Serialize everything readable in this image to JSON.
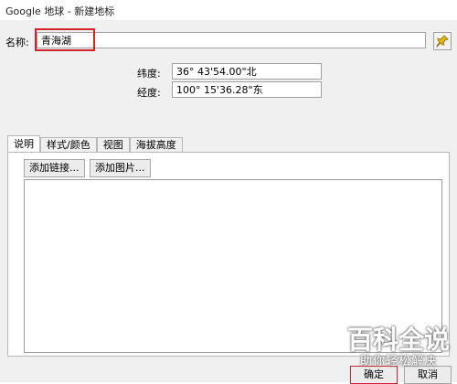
{
  "window": {
    "title": "Google 地球 - 新建地标"
  },
  "name_field": {
    "label": "名称:",
    "value": "青海湖"
  },
  "pin_icon": "pushpin-icon",
  "coordinates": {
    "latitude": {
      "label": "纬度:",
      "value": "36° 43'54.00\"北"
    },
    "longitude": {
      "label": "经度:",
      "value": "100° 15'36.28\"东"
    }
  },
  "tabs": [
    {
      "label": "说明",
      "active": true
    },
    {
      "label": "样式/颜色",
      "active": false
    },
    {
      "label": "视图",
      "active": false
    },
    {
      "label": "海拔高度",
      "active": false
    }
  ],
  "description": {
    "add_link_label": "添加链接...",
    "add_image_label": "添加图片...",
    "text": ""
  },
  "footer": {
    "ok_label": "确定",
    "cancel_label": "取消"
  },
  "watermark": {
    "main": "百科全说",
    "sub": "助你轻松解决"
  },
  "colors": {
    "highlight": "#d2232a",
    "dialog_bg": "#f0f0f0",
    "pin": "#e8b600"
  }
}
